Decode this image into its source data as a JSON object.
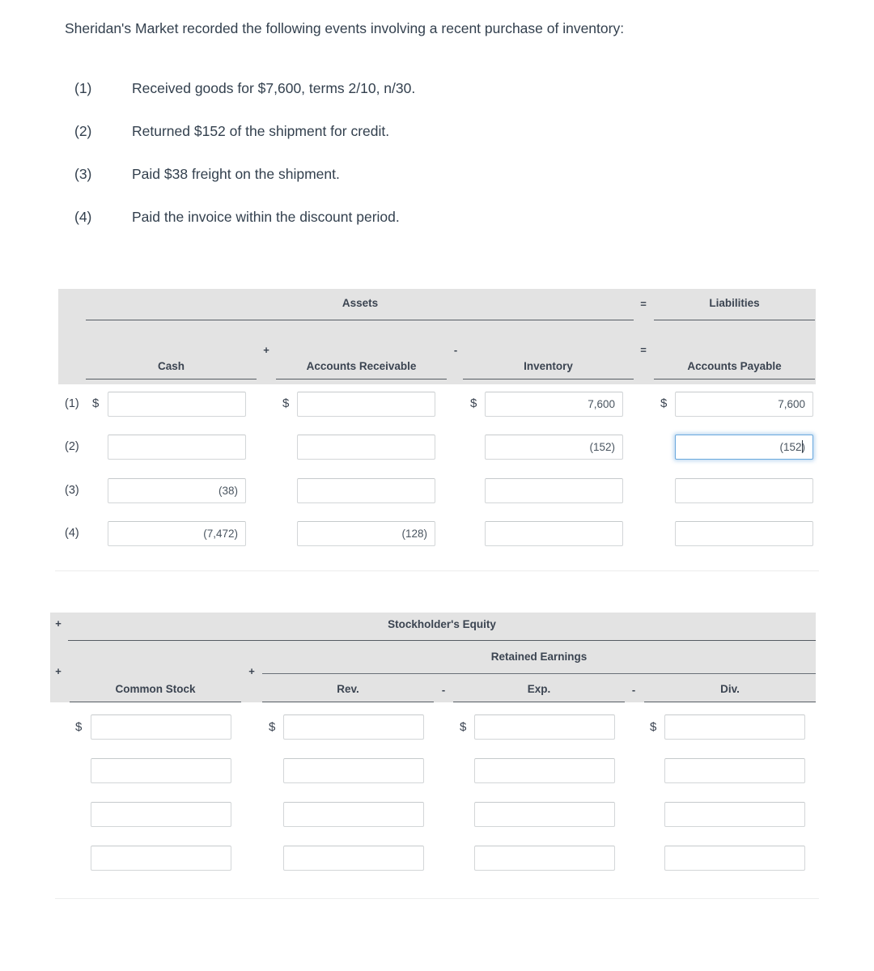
{
  "intro": {
    "text": "Sheridan's Market recorded the following events involving a recent purchase of inventory:"
  },
  "events": [
    {
      "num": "(1)",
      "text": "Received goods for $7,600, terms 2/10, n/30."
    },
    {
      "num": "(2)",
      "text": "Returned $152 of the shipment for credit."
    },
    {
      "num": "(3)",
      "text": "Paid $38 freight on the shipment."
    },
    {
      "num": "(4)",
      "text": "Paid the invoice within the discount period."
    }
  ],
  "table1": {
    "group_headers": {
      "assets": "Assets",
      "liabilities": "Liabilities"
    },
    "group_operators": {
      "equals_top": "=",
      "equals_bottom": "="
    },
    "column_headers": {
      "cash": "Cash",
      "accounts_receivable": "Accounts Receivable",
      "inventory": "Inventory",
      "accounts_payable": "Accounts Payable"
    },
    "column_operators": {
      "plus": "+",
      "minus": "-"
    },
    "row_labels": [
      "(1)",
      "(2)",
      "(3)",
      "(4)"
    ],
    "currency_symbol": "$",
    "values": {
      "cash": [
        "",
        "",
        "(38)",
        "(7,472)"
      ],
      "accounts_receivable": [
        "",
        "",
        "",
        "(128)"
      ],
      "inventory": [
        "7,600",
        "(152)",
        "",
        ""
      ],
      "accounts_payable": [
        "7,600",
        "(152)",
        "",
        ""
      ]
    },
    "focused_cell": {
      "column": "accounts_payable",
      "row": 1,
      "text": "(152",
      "trailing": ")"
    }
  },
  "table2": {
    "group_headers": {
      "stockholders_equity": "Stockholder's Equity",
      "retained_earnings": "Retained Earnings"
    },
    "group_operators": {
      "plus_top": "+",
      "plus_mid": "+",
      "plus_re": "+"
    },
    "column_headers": {
      "common_stock": "Common Stock",
      "rev": "Rev.",
      "exp": "Exp.",
      "div": "Div."
    },
    "column_operators": {
      "plus": "+",
      "minus_1": "-",
      "minus_2": "-"
    },
    "currency_symbol": "$",
    "values": {
      "common_stock": [
        "",
        "",
        "",
        ""
      ],
      "rev": [
        "",
        "",
        "",
        ""
      ],
      "exp": [
        "",
        "",
        "",
        ""
      ],
      "div": [
        "",
        "",
        "",
        ""
      ]
    }
  },
  "colors": {
    "header_band": "#e3e3e3",
    "text": "#3b4451",
    "focus_border": "#6aa8dd",
    "input_border": "#d3d6d8"
  }
}
